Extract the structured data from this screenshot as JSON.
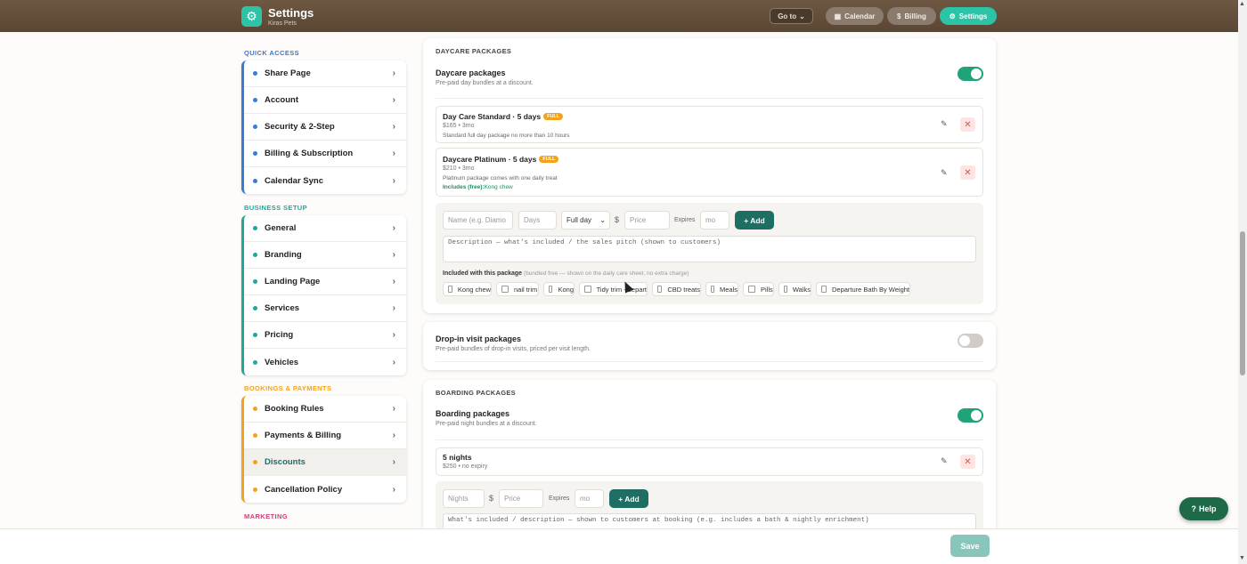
{
  "header": {
    "title": "Settings",
    "subtitle": "Kiras Pets",
    "goto_label": "Go to",
    "nav": [
      {
        "label": "Calendar",
        "icon": "calendar-icon"
      },
      {
        "label": "Billing",
        "icon": "dollar-icon"
      },
      {
        "label": "Settings",
        "icon": "gear-icon",
        "active": true
      }
    ]
  },
  "sidebar": {
    "sections": [
      {
        "title": "QUICK ACCESS",
        "color": "#3a7bd5",
        "items": [
          "Share Page",
          "Account",
          "Security & 2-Step",
          "Billing & Subscription",
          "Calendar Sync"
        ]
      },
      {
        "title": "BUSINESS SETUP",
        "color": "#1fa89a",
        "items": [
          "General",
          "Branding",
          "Landing Page",
          "Services",
          "Pricing",
          "Vehicles"
        ]
      },
      {
        "title": "BOOKINGS & PAYMENTS",
        "color": "#f2a31b",
        "items": [
          "Booking Rules",
          "Payments & Billing",
          "Discounts",
          "Cancellation Policy"
        ],
        "active_item": "Discounts"
      },
      {
        "title": "MARKETING",
        "color": "#d63a7a",
        "items": []
      }
    ]
  },
  "daycare": {
    "section_title": "DAYCARE PACKAGES",
    "toggle_label": "Daycare packages",
    "toggle_sub": "Pre-paid day bundles at a discount.",
    "toggle_on": true,
    "packages": [
      {
        "name": "Day Care Standard · 5 days",
        "badge": "FULL",
        "meta": "$165 • 3mo",
        "desc": "Standard full day package no more than 10 hours",
        "includes_label": "",
        "includes": ""
      },
      {
        "name": "Daycare Platinum · 5 days",
        "badge": "FULL",
        "meta": "$210 • 3mo",
        "desc": "Platinum package comes with one daily treat",
        "includes_label": "Includes (free):",
        "includes": "Kong chew"
      }
    ],
    "form": {
      "name_placeholder": "Name (e.g. Diamo",
      "days_placeholder": "Days",
      "type_value": "Full day",
      "currency": "$",
      "price_placeholder": "Price",
      "expires_label": "Expires",
      "mo_placeholder": "mo",
      "add_label": "+ Add",
      "description_placeholder": "Description — what's included / the sales pitch (shown to customers)",
      "included_label": "Included with this package",
      "included_note": "(bundled free — shown on the daily care sheet, no extra charge)",
      "options": [
        "Kong chew",
        "nail trim",
        "Kong",
        "Tidy trim - depart",
        "CBD treats",
        "Meals",
        "Pills",
        "Walks",
        "Departure Bath By Weight"
      ]
    }
  },
  "dropin": {
    "label": "Drop-in visit packages",
    "sub": "Pre-paid bundles of drop-in visits, priced per visit length.",
    "toggle_on": false
  },
  "boarding": {
    "section_title": "BOARDING PACKAGES",
    "toggle_label": "Boarding packages",
    "toggle_sub": "Pre-paid night bundles at a discount.",
    "toggle_on": true,
    "packages": [
      {
        "name": "5 nights",
        "meta": "$250 • no expiry"
      }
    ],
    "form": {
      "nights_placeholder": "Nights",
      "currency": "$",
      "price_placeholder": "Price",
      "expires_label": "Expires",
      "mo_placeholder": "mo",
      "add_label": "+ Add",
      "description_placeholder": "What's included / description — shown to customers at booking (e.g. includes a bath & nightly enrichment)"
    }
  },
  "footer": {
    "save_label": "Save"
  },
  "help_label": "Help"
}
